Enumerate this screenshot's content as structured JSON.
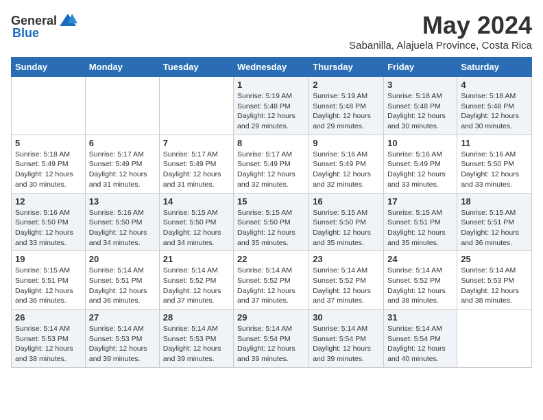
{
  "logo": {
    "general": "General",
    "blue": "Blue"
  },
  "title": "May 2024",
  "subtitle": "Sabanilla, Alajuela Province, Costa Rica",
  "days_header": [
    "Sunday",
    "Monday",
    "Tuesday",
    "Wednesday",
    "Thursday",
    "Friday",
    "Saturday"
  ],
  "weeks": [
    [
      {
        "day": "",
        "info": ""
      },
      {
        "day": "",
        "info": ""
      },
      {
        "day": "",
        "info": ""
      },
      {
        "day": "1",
        "info": "Sunrise: 5:19 AM\nSunset: 5:48 PM\nDaylight: 12 hours and 29 minutes."
      },
      {
        "day": "2",
        "info": "Sunrise: 5:19 AM\nSunset: 5:48 PM\nDaylight: 12 hours and 29 minutes."
      },
      {
        "day": "3",
        "info": "Sunrise: 5:18 AM\nSunset: 5:48 PM\nDaylight: 12 hours and 30 minutes."
      },
      {
        "day": "4",
        "info": "Sunrise: 5:18 AM\nSunset: 5:48 PM\nDaylight: 12 hours and 30 minutes."
      }
    ],
    [
      {
        "day": "5",
        "info": "Sunrise: 5:18 AM\nSunset: 5:49 PM\nDaylight: 12 hours and 30 minutes."
      },
      {
        "day": "6",
        "info": "Sunrise: 5:17 AM\nSunset: 5:49 PM\nDaylight: 12 hours and 31 minutes."
      },
      {
        "day": "7",
        "info": "Sunrise: 5:17 AM\nSunset: 5:49 PM\nDaylight: 12 hours and 31 minutes."
      },
      {
        "day": "8",
        "info": "Sunrise: 5:17 AM\nSunset: 5:49 PM\nDaylight: 12 hours and 32 minutes."
      },
      {
        "day": "9",
        "info": "Sunrise: 5:16 AM\nSunset: 5:49 PM\nDaylight: 12 hours and 32 minutes."
      },
      {
        "day": "10",
        "info": "Sunrise: 5:16 AM\nSunset: 5:49 PM\nDaylight: 12 hours and 33 minutes."
      },
      {
        "day": "11",
        "info": "Sunrise: 5:16 AM\nSunset: 5:50 PM\nDaylight: 12 hours and 33 minutes."
      }
    ],
    [
      {
        "day": "12",
        "info": "Sunrise: 5:16 AM\nSunset: 5:50 PM\nDaylight: 12 hours and 33 minutes."
      },
      {
        "day": "13",
        "info": "Sunrise: 5:16 AM\nSunset: 5:50 PM\nDaylight: 12 hours and 34 minutes."
      },
      {
        "day": "14",
        "info": "Sunrise: 5:15 AM\nSunset: 5:50 PM\nDaylight: 12 hours and 34 minutes."
      },
      {
        "day": "15",
        "info": "Sunrise: 5:15 AM\nSunset: 5:50 PM\nDaylight: 12 hours and 35 minutes."
      },
      {
        "day": "16",
        "info": "Sunrise: 5:15 AM\nSunset: 5:50 PM\nDaylight: 12 hours and 35 minutes."
      },
      {
        "day": "17",
        "info": "Sunrise: 5:15 AM\nSunset: 5:51 PM\nDaylight: 12 hours and 35 minutes."
      },
      {
        "day": "18",
        "info": "Sunrise: 5:15 AM\nSunset: 5:51 PM\nDaylight: 12 hours and 36 minutes."
      }
    ],
    [
      {
        "day": "19",
        "info": "Sunrise: 5:15 AM\nSunset: 5:51 PM\nDaylight: 12 hours and 36 minutes."
      },
      {
        "day": "20",
        "info": "Sunrise: 5:14 AM\nSunset: 5:51 PM\nDaylight: 12 hours and 36 minutes."
      },
      {
        "day": "21",
        "info": "Sunrise: 5:14 AM\nSunset: 5:52 PM\nDaylight: 12 hours and 37 minutes."
      },
      {
        "day": "22",
        "info": "Sunrise: 5:14 AM\nSunset: 5:52 PM\nDaylight: 12 hours and 37 minutes."
      },
      {
        "day": "23",
        "info": "Sunrise: 5:14 AM\nSunset: 5:52 PM\nDaylight: 12 hours and 37 minutes."
      },
      {
        "day": "24",
        "info": "Sunrise: 5:14 AM\nSunset: 5:52 PM\nDaylight: 12 hours and 38 minutes."
      },
      {
        "day": "25",
        "info": "Sunrise: 5:14 AM\nSunset: 5:53 PM\nDaylight: 12 hours and 38 minutes."
      }
    ],
    [
      {
        "day": "26",
        "info": "Sunrise: 5:14 AM\nSunset: 5:53 PM\nDaylight: 12 hours and 38 minutes."
      },
      {
        "day": "27",
        "info": "Sunrise: 5:14 AM\nSunset: 5:53 PM\nDaylight: 12 hours and 39 minutes."
      },
      {
        "day": "28",
        "info": "Sunrise: 5:14 AM\nSunset: 5:53 PM\nDaylight: 12 hours and 39 minutes."
      },
      {
        "day": "29",
        "info": "Sunrise: 5:14 AM\nSunset: 5:54 PM\nDaylight: 12 hours and 39 minutes."
      },
      {
        "day": "30",
        "info": "Sunrise: 5:14 AM\nSunset: 5:54 PM\nDaylight: 12 hours and 39 minutes."
      },
      {
        "day": "31",
        "info": "Sunrise: 5:14 AM\nSunset: 5:54 PM\nDaylight: 12 hours and 40 minutes."
      },
      {
        "day": "",
        "info": ""
      }
    ]
  ]
}
